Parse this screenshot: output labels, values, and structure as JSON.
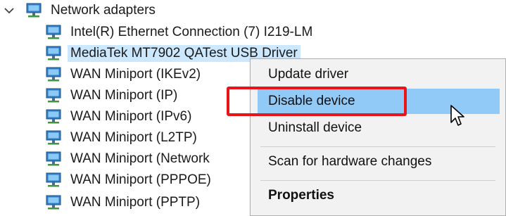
{
  "tree": {
    "category": {
      "label": "Network adapters",
      "icon": "network-adapter-icon"
    },
    "devices": [
      {
        "label": "Intel(R) Ethernet Connection (7) I219-LM",
        "icon": "network-adapter-icon",
        "selected": false
      },
      {
        "label": "MediaTek MT7902 QATest USB Driver",
        "icon": "network-adapter-icon",
        "selected": true
      },
      {
        "label": "WAN Miniport (IKEv2)",
        "icon": "network-adapter-icon",
        "selected": false
      },
      {
        "label": "WAN Miniport (IP)",
        "icon": "network-adapter-icon",
        "selected": false
      },
      {
        "label": "WAN Miniport (IPv6)",
        "icon": "network-adapter-icon",
        "selected": false
      },
      {
        "label": "WAN Miniport (L2TP)",
        "icon": "network-adapter-icon",
        "selected": false
      },
      {
        "label": "WAN Miniport (Network",
        "icon": "network-adapter-icon",
        "selected": false
      },
      {
        "label": "WAN Miniport (PPPOE)",
        "icon": "network-adapter-icon",
        "selected": false
      },
      {
        "label": "WAN Miniport (PPTP)",
        "icon": "network-adapter-icon",
        "selected": false
      }
    ]
  },
  "context_menu": {
    "items": [
      {
        "label": "Update driver"
      },
      {
        "label": "Disable device",
        "highlighted": true
      },
      {
        "label": "Uninstall device"
      },
      {
        "label": "Scan for hardware changes"
      },
      {
        "label": "Properties",
        "bold": true
      }
    ]
  },
  "colors": {
    "selection": "#cce8ff",
    "menu_highlight": "#91c9f7",
    "menu_background": "#f2f2f2",
    "annotation_red": "#e8141a"
  }
}
